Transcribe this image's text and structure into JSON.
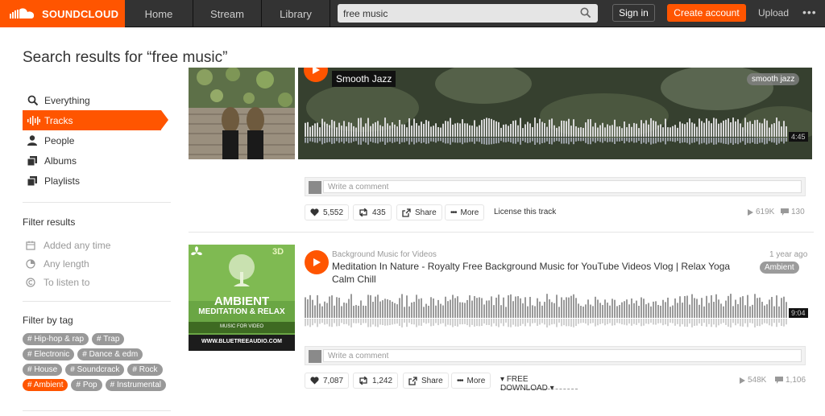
{
  "brand": {
    "name": "SOUNDCLOUD",
    "color": "#ff5500"
  },
  "nav": {
    "home": "Home",
    "stream": "Stream",
    "library": "Library",
    "search_value": "free music",
    "sign_in": "Sign in",
    "create_account": "Create account",
    "upload": "Upload",
    "more": "•••"
  },
  "page_title": "Search results for “free music”",
  "sidebar": {
    "items": [
      {
        "label": "Everything",
        "icon": "search-icon"
      },
      {
        "label": "Tracks",
        "icon": "waveform-icon"
      },
      {
        "label": "People",
        "icon": "person-icon"
      },
      {
        "label": "Albums",
        "icon": "album-icon"
      },
      {
        "label": "Playlists",
        "icon": "playlist-icon"
      }
    ]
  },
  "filters": {
    "heading": "Filter results",
    "added": "Added any time",
    "length": "Any length",
    "listen": "To listen to"
  },
  "tags": {
    "heading": "Filter by tag",
    "items": [
      "Hip-hop & rap",
      "Trap",
      "Electronic",
      "Dance & edm",
      "House",
      "Soundcrack",
      "Rock",
      "Ambient",
      "Pop",
      "Instrumental"
    ],
    "active": "Ambient"
  },
  "track1": {
    "title": "Smooth Jazz",
    "tag": "smooth jazz",
    "duration": "4:45",
    "comment_placeholder": "Write a comment",
    "likes": "5,552",
    "reposts": "435",
    "share": "Share",
    "more": "More",
    "license": "License this track",
    "plays": "619K",
    "comments": "130"
  },
  "track2": {
    "uploader": "Background Music for Videos",
    "time_ago": "1 year ago",
    "title": "Meditation In Nature - Royalty Free Background Music for YouTube Videos Vlog | Relax Yoga Calm Chill",
    "tag": "Ambient",
    "duration": "9:04",
    "comment_placeholder": "Write a comment",
    "likes": "7,087",
    "reposts": "1,242",
    "share": "Share",
    "more": "More",
    "free_download": "FREE DOWNLOAD",
    "plays": "548K",
    "comments": "1,106",
    "art": {
      "badge": "3D",
      "line1": "AMBIENT",
      "line2": "MEDITATION & RELAX",
      "line3": "MUSIC FOR VIDEO",
      "url": "WWW.BLUETREEAUDIO.COM"
    }
  }
}
